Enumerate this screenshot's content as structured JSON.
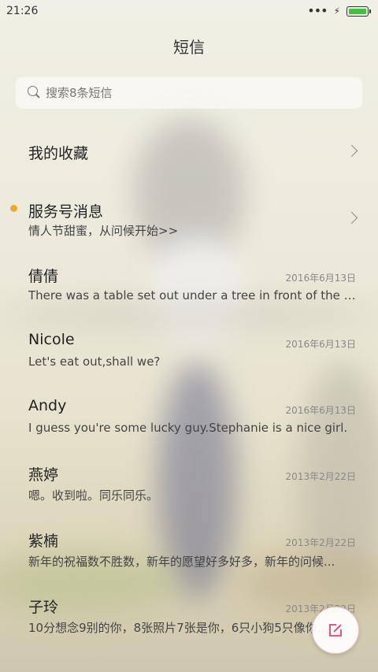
{
  "status": {
    "time": "21:26"
  },
  "header": {
    "title": "短信"
  },
  "search": {
    "placeholder": "搜索8条短信"
  },
  "favorites": {
    "label": "我的收藏"
  },
  "service": {
    "title": "服务号消息",
    "subtitle": "情人节甜蜜，从问候开始>>"
  },
  "messages": [
    {
      "name": "倩倩",
      "date": "2016年6月13日",
      "preview": "There was a table set out under a tree in front of the ho..."
    },
    {
      "name": "Nicole",
      "date": "2016年6月13日",
      "preview": "Let's eat out,shall we?"
    },
    {
      "name": "Andy",
      "date": "2016年6月13日",
      "preview": "I guess you're some lucky guy.Stephanie is a nice girl."
    },
    {
      "name": "燕婷",
      "date": "2013年2月22日",
      "preview": "嗯。收到啦。同乐同乐。"
    },
    {
      "name": "紫楠",
      "date": "2013年2月22日",
      "preview": "新年的祝福数不胜数，新年的愿望好多好多，新年的问候..."
    },
    {
      "name": "子玲",
      "date": "2013年2月22日",
      "preview": "10分想念9别的你，8张照片7张是你，6只小狗5只像你..."
    }
  ],
  "icons": {
    "compose": "compose-icon",
    "search": "search-icon",
    "chevron": "chevron-right-icon"
  },
  "colors": {
    "unread_dot": "#f5a623",
    "battery": "#42c13a"
  }
}
